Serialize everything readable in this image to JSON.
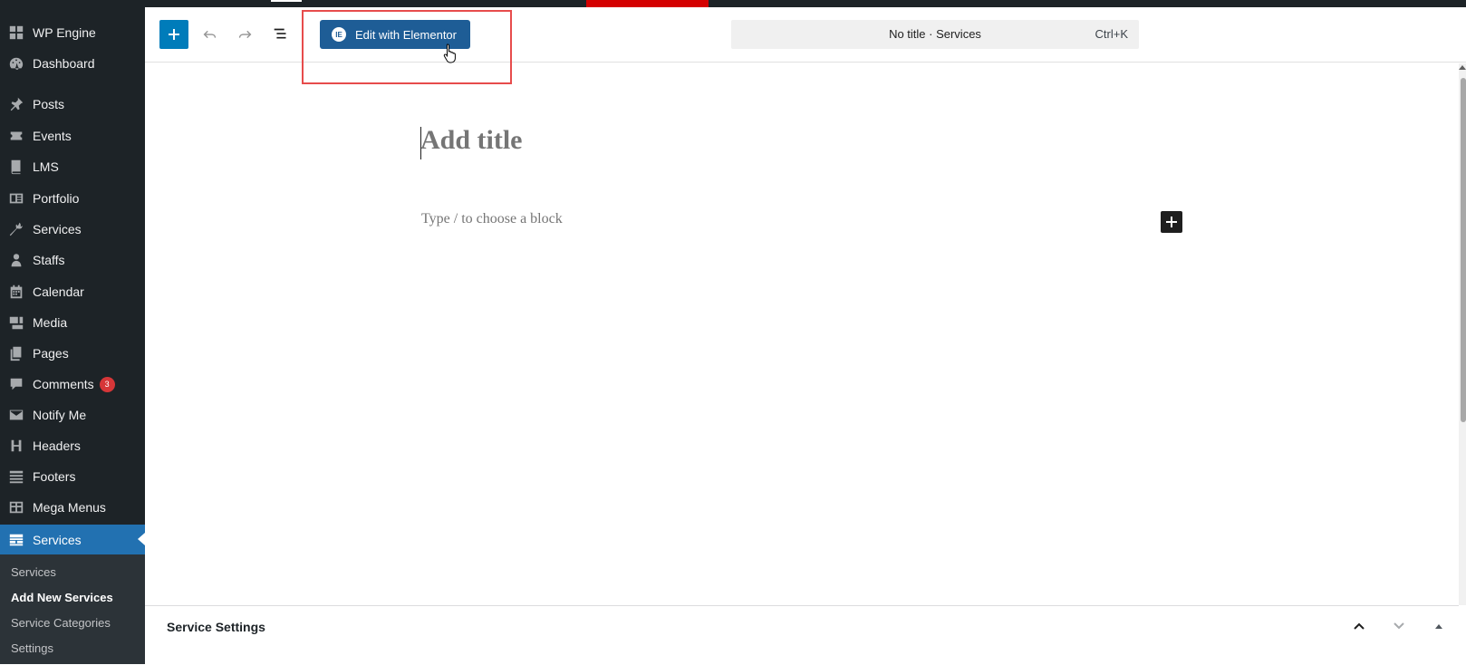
{
  "sidebar": {
    "items": [
      {
        "label": "WP Engine",
        "icon": "grid-icon"
      },
      {
        "label": "Dashboard",
        "icon": "dashboard-icon"
      },
      {
        "label": "Posts",
        "icon": "pushpin-icon"
      },
      {
        "label": "Events",
        "icon": "ticket-icon"
      },
      {
        "label": "LMS",
        "icon": "book-icon"
      },
      {
        "label": "Portfolio",
        "icon": "portfolio-icon"
      },
      {
        "label": "Services",
        "icon": "carrot-icon"
      },
      {
        "label": "Staffs",
        "icon": "person-icon"
      },
      {
        "label": "Calendar",
        "icon": "calendar-icon"
      },
      {
        "label": "Media",
        "icon": "media-icon"
      },
      {
        "label": "Pages",
        "icon": "pages-icon"
      },
      {
        "label": "Comments",
        "icon": "comment-icon",
        "badge": "3"
      },
      {
        "label": "Notify Me",
        "icon": "envelope-icon"
      },
      {
        "label": "Headers",
        "icon": "heading-icon"
      },
      {
        "label": "Footers",
        "icon": "footer-icon"
      },
      {
        "label": "Mega Menus",
        "icon": "table-icon"
      },
      {
        "label": "Services",
        "icon": "services-icon",
        "active": true
      }
    ],
    "submenu": [
      {
        "label": "Services"
      },
      {
        "label": "Add New Services",
        "current": true
      },
      {
        "label": "Service Categories"
      },
      {
        "label": "Settings"
      }
    ]
  },
  "header": {
    "elementor_label": "Edit with Elementor",
    "elementor_logo": "IE",
    "command_title": "No title · Services",
    "command_shortcut": "Ctrl+K"
  },
  "canvas": {
    "title_placeholder": "Add title",
    "block_placeholder": "Type / to choose a block"
  },
  "metabox": {
    "title": "Service Settings"
  },
  "colors": {
    "sidebar_bg": "#1d2327",
    "accent": "#2271b1",
    "elementor": "#1e5d96",
    "highlight": "#e74c4c",
    "badge": "#d63638"
  }
}
